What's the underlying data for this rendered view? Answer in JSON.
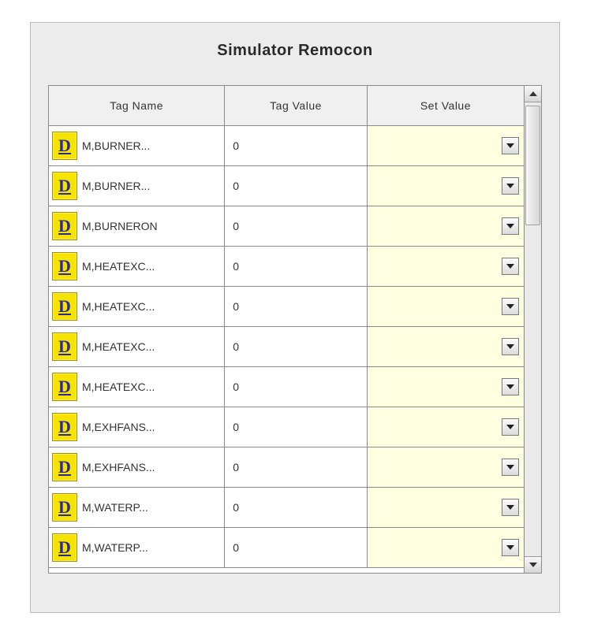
{
  "title": "Simulator Remocon",
  "columns": {
    "name": "Tag Name",
    "value": "Tag Value",
    "set": "Set Value"
  },
  "badge_letter": "D",
  "rows": [
    {
      "name": "M,BURNER...",
      "value": "0"
    },
    {
      "name": "M,BURNER...",
      "value": "0"
    },
    {
      "name": "M,BURNERON",
      "value": "0"
    },
    {
      "name": "M,HEATEXC...",
      "value": "0"
    },
    {
      "name": "M,HEATEXC...",
      "value": "0"
    },
    {
      "name": "M,HEATEXC...",
      "value": "0"
    },
    {
      "name": "M,HEATEXC...",
      "value": "0"
    },
    {
      "name": "M,EXHFANS...",
      "value": "0"
    },
    {
      "name": "M,EXHFANS...",
      "value": "0"
    },
    {
      "name": "M,WATERP...",
      "value": "0"
    },
    {
      "name": "M,WATERP...",
      "value": "0"
    }
  ]
}
